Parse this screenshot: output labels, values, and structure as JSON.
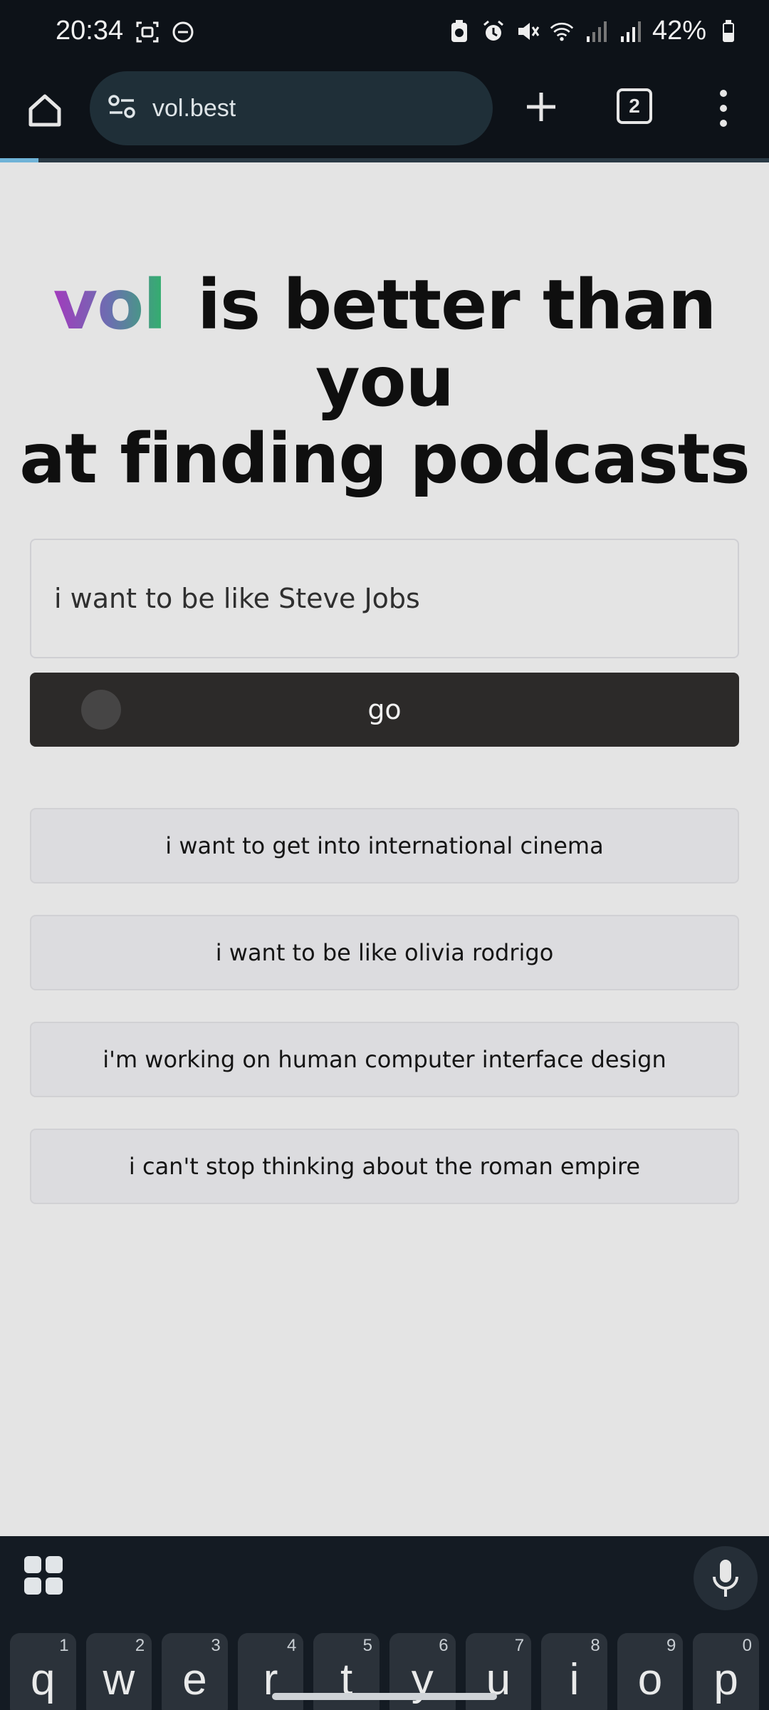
{
  "status_bar": {
    "time": "20:34",
    "battery": "42%",
    "icons_left": [
      "screenshot-icon",
      "dnd-icon"
    ],
    "icons_right": [
      "battery-saver-icon",
      "alarm-icon",
      "mute-icon",
      "wifi-icon",
      "signal-icon",
      "signal-icon"
    ]
  },
  "browser": {
    "url": "vol.best",
    "tab_count": "2",
    "load_progress": 0.05
  },
  "page": {
    "brand": "vol",
    "headline_rest": "is better than you",
    "headline_line2": "at finding podcasts",
    "search_value": "i want to be like Steve Jobs",
    "go_label": "go",
    "suggestions": [
      "i want to get into international cinema",
      "i want to be like olivia rodrigo",
      "i'm working on human computer interface design",
      "i can't stop thinking about the roman empire"
    ]
  },
  "keyboard": {
    "keys": [
      {
        "letter": "q",
        "num": "1"
      },
      {
        "letter": "w",
        "num": "2"
      },
      {
        "letter": "e",
        "num": "3"
      },
      {
        "letter": "r",
        "num": "4"
      },
      {
        "letter": "t",
        "num": "5"
      },
      {
        "letter": "y",
        "num": "6"
      },
      {
        "letter": "u",
        "num": "7"
      },
      {
        "letter": "i",
        "num": "8"
      },
      {
        "letter": "o",
        "num": "9"
      },
      {
        "letter": "p",
        "num": "0"
      }
    ]
  },
  "colors": {
    "brand_gradient": [
      "#a23bbd",
      "#6b6fb0",
      "#2fb36a"
    ],
    "go_button": "#2c2a29"
  }
}
